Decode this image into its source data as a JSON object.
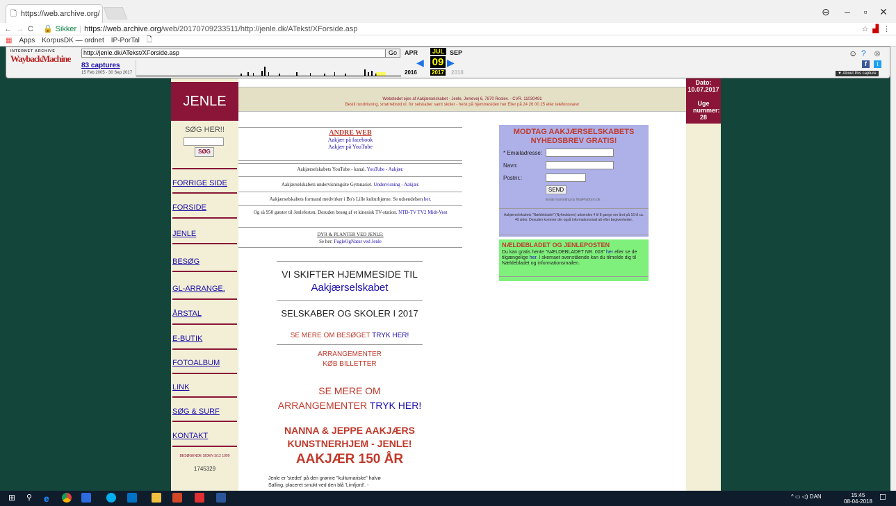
{
  "browser": {
    "tab_title": "https://web.archive.org/",
    "secure_label": "Sikker",
    "url_host": "https://web.archive.org",
    "url_path": "/web/20170709233511/http://jenle.dk/ATekst/XForside.asp",
    "bookmarks": [
      "Apps",
      "KorpusDK — ordnet",
      "IP-PorTal"
    ]
  },
  "wayback": {
    "url": "http://jenle.dk/ATekst/XForside.asp",
    "go_label": "Go",
    "captures": "83 captures",
    "capture_range": "15 Feb 2005 - 30 Sep 2017",
    "prev_month": "APR",
    "cur_month": "JUL",
    "next_month": "SEP",
    "day": "09",
    "year_prev": "2016",
    "year_cur": "2017",
    "year_next": "2018",
    "about": "▼ About this capture"
  },
  "site": {
    "title": "JENLE",
    "header_line1": "Webstedet ejes af Aakjærselskabet - Jenle, Jenlevej 6, 7870 Roslev. - CVR. 11030491",
    "header_line2": "Bestil rundvisning, smørrebrød ol. for selskaber samt skoler - helst på hjemmesiden her Eller på 24 26 00 25 eller telefonsvarer",
    "date_label": "Dato:",
    "date_value": "10.07.2017",
    "week_label": "Uge nummer:",
    "week_value": "28"
  },
  "nav": {
    "search_label": "SØG HER!!",
    "search_button": "SØG",
    "items": [
      "FORRIGE SIDE",
      "FORSIDE",
      "JENLE",
      "BESØG",
      "GL-ARRANGE.",
      "ÅRSTAL",
      "E-BUTIK",
      "FOTOALBUM",
      "LINK",
      "SØG & SURF",
      "KONTAKT"
    ],
    "visits_text": "BESØGENDE SIDEN 3/12 1999",
    "visits_count": "1745329"
  },
  "content": {
    "andre_title": "ANDRE WEB",
    "andre_link1": "Aakjær på facebook",
    "andre_link2": "Aakjær på YouTube",
    "row1_text": "Aakjærselskabets YouTube - kanal.",
    "row1_link": "YouTube - Aakjær.",
    "row2_text": "Aakjærselskabets undervisningsite Gymnasiet.",
    "row2_link": "Undervisning - Aakjær.",
    "row3_text": "Aakjærselskabets formand medvirker i Bo's Lille kulturhjørne. Se udsendelsen",
    "row3_link": "her.",
    "row4_text": "Og så 950 gæster til Jenlefesten. Desuden besøg af et kinesisk TV-station.",
    "row4_link": "NTD-TV TV2 Midt-Vest",
    "row5_title": "DYR & PLANTER VED JENLE:",
    "row5_text": "Se her:",
    "row5_link": "FugleOgNatur ved Jenle",
    "skifter": "VI SKIFTER HJEMMESIDE TIL",
    "skifter_link": "Aakjærselskabet",
    "selskaber": "SELSKABER OG SKOLER I 2017",
    "se_mere": "SE MERE OM BESØGET",
    "tryk_her": "TRYK HER!",
    "arrangementer": "ARRANGEMENTER",
    "kob": "KØB BILLETTER",
    "se_mere_om": "SE MERE OM",
    "arr2": "ARRANGEMENTER",
    "tryk_her2": "TRYK HER!",
    "nanna1": "NANNA & JEPPE AAKJÆRS",
    "nanna2": "KUNSTNERHJEM - JENLE!",
    "aakjaer150": "AAKJÆR 150 ÅR",
    "intro1": "Jenle er 'stedet' på den grønne \"kulturnariske\" halvø",
    "intro2": "Salling, placeret smukt ved den blå 'Limfjord'. -"
  },
  "newsletter": {
    "title": "MODTAG AAKJÆRSELSKABETS NYHEDSBREV GRATIS!",
    "email_label": "* Emailadresse:",
    "name_label": "Navn:",
    "zip_label": "Postnr.:",
    "send": "SEND",
    "marketing": "Email marketing by MailPlatform.dk",
    "note": "Aakjærselskabets \"Nældebladet\" (Nyhedsbrev) udsendes 4 til 8 gange om året på 16 til ca. 40 sider. Desuden kommer der også informationsmail alt efter begivenheder."
  },
  "naelde": {
    "title": "NÆLDEBLADET OG JENLEPOSTEN",
    "text1": "Du kan gratis hente \"NÆLDEBLADET NR. 003\"",
    "link1": "her",
    "text2": "eller se de tilgængelige",
    "link2": "her.",
    "text3": "I skemaet ovenstående kan du tilmelde dig til Nældebladet og informationsmailen."
  },
  "taskbar": {
    "lang": "DAN",
    "time": "15:45",
    "date": "08-04-2018"
  },
  "colors": {
    "maroon": "#8a1538",
    "beige": "#f2efd6",
    "bg": "#14453a"
  }
}
